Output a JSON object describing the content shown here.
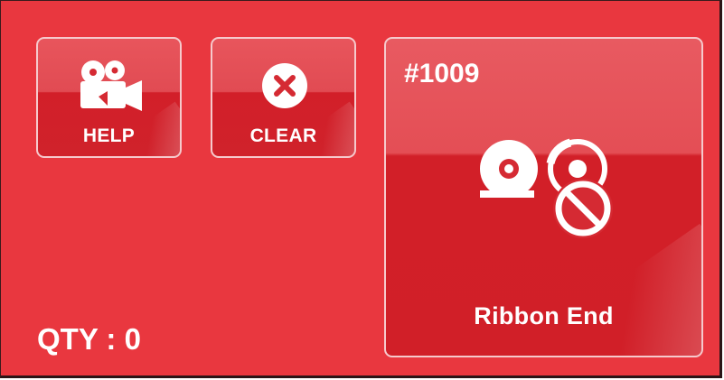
{
  "colors": {
    "background": "#e9373f",
    "tile_red": "#d21f29",
    "tile_border": "#f6c9cc",
    "text": "#ffffff"
  },
  "buttons": {
    "help": {
      "label": "HELP",
      "icon": "video-camera-icon"
    },
    "clear": {
      "label": "CLEAR",
      "icon": "close-circle-icon"
    }
  },
  "status_tile": {
    "code": "#1009",
    "label": "Ribbon End",
    "icon": "ribbon-end-icon"
  },
  "quantity": {
    "text": "QTY : 0"
  }
}
